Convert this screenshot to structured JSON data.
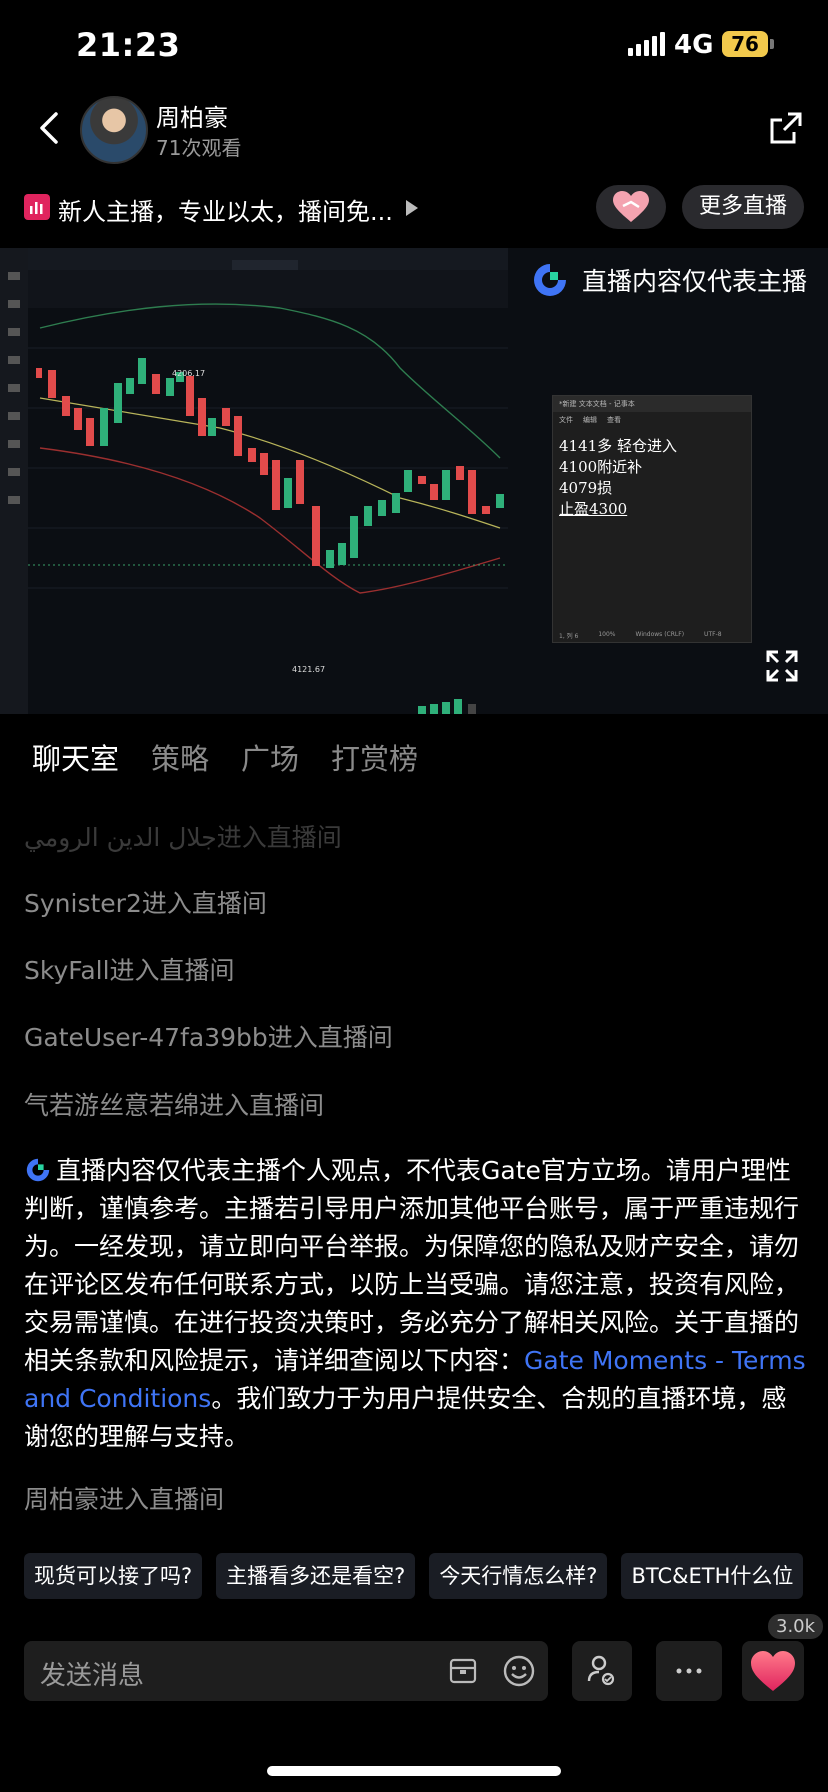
{
  "status_bar": {
    "time": "21:23",
    "network": "4G",
    "battery": "76"
  },
  "header": {
    "host_name": "周柏豪",
    "view_count": "71次观看"
  },
  "notice": {
    "text": "新人主播，专业以太，播间免...",
    "more_live_label": "更多直播"
  },
  "video": {
    "overlay_text": "直播内容仅代表主播",
    "notepad": {
      "title": "*新建 文本文档 - 记事本",
      "menu": [
        "文件",
        "编辑",
        "查看"
      ],
      "lines": [
        "4141多  轻仓进入",
        "4100附近补",
        "4079损",
        "止盈4300"
      ],
      "status": [
        "1, 列 6",
        "100%",
        "Windows (CRLF)",
        "UTF-8"
      ]
    },
    "chart_labels": {
      "high": "4206.17",
      "low": "4121.67"
    }
  },
  "tabs": [
    "聊天室",
    "策略",
    "广场",
    "打赏榜"
  ],
  "chat": {
    "faded_line": "جلال الدين الرومي进入直播间",
    "lines": [
      "Synister2进入直播间",
      "SkyFall进入直播间",
      "GateUser-47fa39bb进入直播间",
      "气若游丝意若绵进入直播间"
    ],
    "disclaimer_before": "直播内容仅代表主播个人观点，不代表Gate官方立场。请用户理性判断，谨慎参考。主播若引导用户添加其他平台账号，属于严重违规行为。一经发现，请立即向平台举报。为保障您的隐私及财产安全，请勿在评论区发布任何联系方式，以防上当受骗。请您注意，投资有风险，交易需谨慎。在进行投资决策时，务必充分了解相关风险。关于直播的相关条款和风险提示，请详细查阅以下内容：",
    "disclaimer_link": "Gate Moments - Terms and Conditions",
    "disclaimer_after": "。我们致力于为用户提供安全、合规的直播环境，感谢您的理解与支持。",
    "last_line": "周柏豪进入直播间"
  },
  "quick_replies": [
    "现货可以接了吗?",
    "主播看多还是看空?",
    "今天行情怎么样?",
    "BTC&ETH什么位"
  ],
  "bottom_bar": {
    "placeholder": "发送消息",
    "like_count": "3.0k"
  },
  "colors": {
    "accent_blue": "#3f74f5",
    "like_red": "#e0245e",
    "battery_yellow": "#f2c94c"
  }
}
